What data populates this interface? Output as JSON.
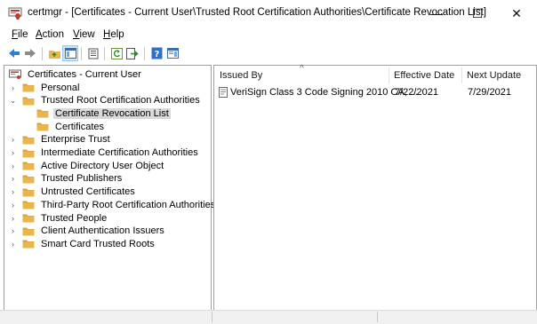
{
  "window": {
    "title": "certmgr - [Certificates - Current User\\Trusted Root Certification Authorities\\Certificate Revocation List]",
    "minimize_glyph": "—",
    "maximize_glyph": "☐",
    "close_glyph": "✕"
  },
  "menu": [
    {
      "label": "File",
      "mnemonic": "F",
      "rest": "ile"
    },
    {
      "label": "Action",
      "mnemonic": "A",
      "rest": "ction"
    },
    {
      "label": "View",
      "mnemonic": "V",
      "rest": "iew"
    },
    {
      "label": "Help",
      "mnemonic": "H",
      "rest": "elp"
    }
  ],
  "toolbar": {
    "icons": [
      "back-arrow-icon",
      "forward-arrow-icon",
      "up-folder-icon",
      "show-hide-tree-icon",
      "properties-icon",
      "refresh-icon",
      "export-list-icon",
      "help-icon",
      "help-pane-icon"
    ]
  },
  "tree": {
    "root": "Certificates - Current User",
    "items": [
      {
        "label": "Personal",
        "twisty": "›"
      },
      {
        "label": "Trusted Root Certification Authorities",
        "twisty": "⌄"
      },
      {
        "label": "Certificate Revocation List",
        "twisty": ""
      },
      {
        "label": "Certificates",
        "twisty": ""
      },
      {
        "label": "Enterprise Trust",
        "twisty": "›"
      },
      {
        "label": "Intermediate Certification Authorities",
        "twisty": "›"
      },
      {
        "label": "Active Directory User Object",
        "twisty": "›"
      },
      {
        "label": "Trusted Publishers",
        "twisty": "›"
      },
      {
        "label": "Untrusted Certificates",
        "twisty": "›"
      },
      {
        "label": "Third-Party Root Certification Authorities",
        "twisty": "›"
      },
      {
        "label": "Trusted People",
        "twisty": "›"
      },
      {
        "label": "Client Authentication Issuers",
        "twisty": "›"
      },
      {
        "label": "Smart Card Trusted Roots",
        "twisty": "›"
      }
    ]
  },
  "list": {
    "columns": [
      "Issued By",
      "Effective Date",
      "Next Update"
    ],
    "sort_indicator": "^",
    "rows": [
      {
        "issued_by": "VeriSign Class 3 Code Signing 2010 CA, ...",
        "effective_date": "7/22/2021",
        "next_update": "7/29/2021"
      }
    ]
  },
  "colors": {
    "folder": "#e8b64c",
    "folder_dark": "#d9a23a",
    "selection": "#d9d9d9",
    "back_arrow": "#2d7dd2",
    "help_icon": "#2f6fc4"
  }
}
